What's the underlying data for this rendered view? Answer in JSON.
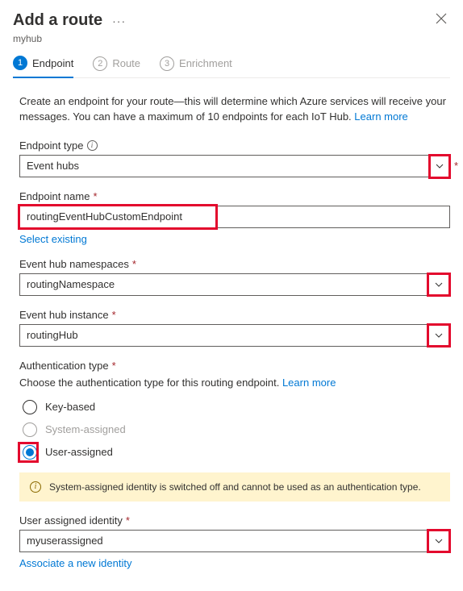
{
  "header": {
    "title": "Add a route",
    "subtitle": "myhub"
  },
  "tabs": [
    {
      "num": "1",
      "label": "Endpoint"
    },
    {
      "num": "2",
      "label": "Route"
    },
    {
      "num": "3",
      "label": "Enrichment"
    }
  ],
  "intro": {
    "text": "Create an endpoint for your route—this will determine which Azure services will receive your messages. You can have a maximum of 10 endpoints for each IoT Hub. ",
    "link": "Learn more"
  },
  "endpoint_type": {
    "label": "Endpoint type",
    "value": "Event hubs"
  },
  "endpoint_name": {
    "label": "Endpoint name",
    "value": "routingEventHubCustomEndpoint",
    "sublink": "Select existing"
  },
  "namespaces": {
    "label": "Event hub namespaces",
    "value": "routingNamespace"
  },
  "instance": {
    "label": "Event hub instance",
    "value": "routingHub"
  },
  "auth": {
    "label": "Authentication type",
    "desc": "Choose the authentication type for this routing endpoint. ",
    "link": "Learn more",
    "options": {
      "key": "Key-based",
      "system": "System-assigned",
      "user": "User-assigned"
    },
    "banner": "System-assigned identity is switched off and cannot be used as an authentication type."
  },
  "identity": {
    "label": "User assigned identity",
    "value": "myuserassigned",
    "sublink": "Associate a new identity"
  }
}
